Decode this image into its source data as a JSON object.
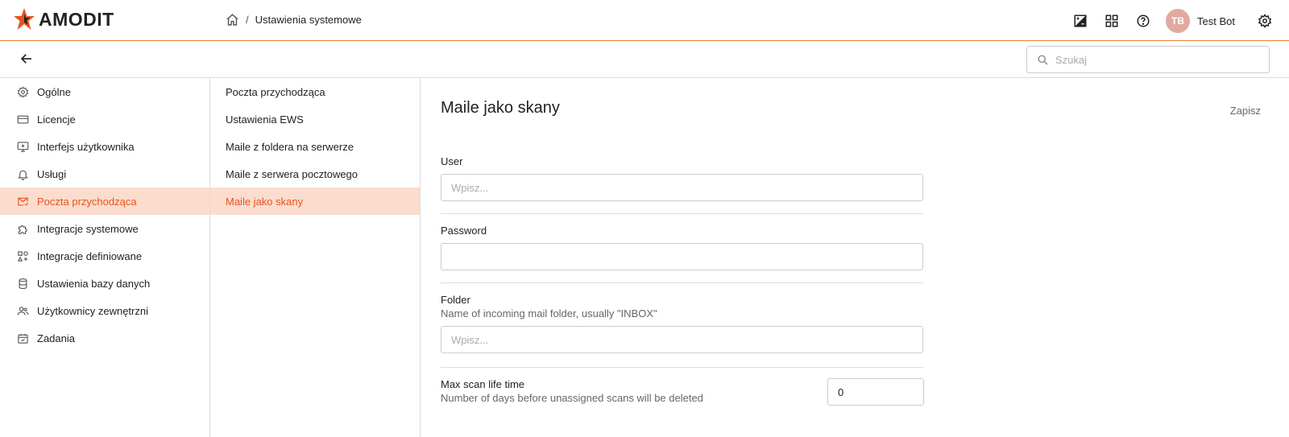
{
  "brand": {
    "name": "AMODIT",
    "accent": "#e8531e"
  },
  "breadcrumb": {
    "home_icon": "home-icon",
    "separator": "/",
    "current": "Ustawienia systemowe"
  },
  "header": {
    "user_initials": "TB",
    "user_name": "Test Bot",
    "icons": [
      "contrast-icon",
      "apps-icon",
      "help-icon",
      "gear-icon"
    ]
  },
  "search": {
    "placeholder": "Szukaj",
    "value": ""
  },
  "nav_main": {
    "items": [
      {
        "label": "Ogólne",
        "icon": "gear-icon"
      },
      {
        "label": "Licencje",
        "icon": "card-icon"
      },
      {
        "label": "Interfejs użytkownika",
        "icon": "monitor-icon"
      },
      {
        "label": "Usługi",
        "icon": "bell-icon"
      },
      {
        "label": "Poczta przychodząca",
        "icon": "mail-icon",
        "active": true
      },
      {
        "label": "Integracje systemowe",
        "icon": "puzzle-icon"
      },
      {
        "label": "Integracje definiowane",
        "icon": "widgets-icon"
      },
      {
        "label": "Ustawienia bazy danych",
        "icon": "database-icon"
      },
      {
        "label": "Użytkownicy zewnętrzni",
        "icon": "users-icon"
      },
      {
        "label": "Zadania",
        "icon": "calendar-check-icon"
      }
    ]
  },
  "nav_sub": {
    "items": [
      {
        "label": "Poczta przychodząca"
      },
      {
        "label": "Ustawienia EWS"
      },
      {
        "label": "Maile z foldera na serwerze"
      },
      {
        "label": "Maile z serwera pocztowego"
      },
      {
        "label": "Maile jako skany",
        "active": true
      }
    ]
  },
  "main": {
    "title": "Maile jako skany",
    "save_label": "Zapisz",
    "fields": {
      "user": {
        "label": "User",
        "placeholder": "Wpisz...",
        "value": ""
      },
      "password": {
        "label": "Password",
        "placeholder": "",
        "value": ""
      },
      "folder": {
        "label": "Folder",
        "description": "Name of incoming mail folder, usually \"INBOX\"",
        "placeholder": "Wpisz...",
        "value": ""
      },
      "max_scan": {
        "label": "Max scan life time",
        "description": "Number of days before unassigned scans will be deleted",
        "value": "0"
      }
    }
  }
}
